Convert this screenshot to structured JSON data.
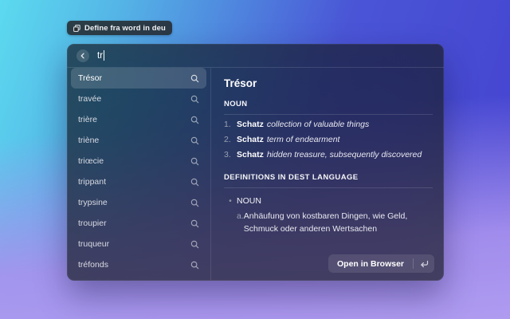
{
  "colors": {
    "backdrop_top_left": "#5cdaf0",
    "backdrop_top_right": "#4441d0",
    "backdrop_bottom": "#af9cf0",
    "window_tint": "rgba(26,30,40,0.72)",
    "selection": "rgba(255,255,255,0.15)"
  },
  "launcher_badge": {
    "icon": "window-copy-icon",
    "label": "Define fra word in deu"
  },
  "window": {
    "search": {
      "value": "tr",
      "back_icon": "chevron-left-icon"
    },
    "results": [
      {
        "label": "Trésor",
        "selected": true
      },
      {
        "label": "travée"
      },
      {
        "label": "trière"
      },
      {
        "label": "triène"
      },
      {
        "label": "triœcie"
      },
      {
        "label": "trippant"
      },
      {
        "label": "trypsine"
      },
      {
        "label": "troupier"
      },
      {
        "label": "truqueur"
      },
      {
        "label": "tréfonds"
      }
    ],
    "detail": {
      "title": "Trésor",
      "pos_heading": "NOUN",
      "definitions": [
        {
          "num": "1.",
          "word": "Schatz",
          "gloss": "collection of valuable things"
        },
        {
          "num": "2.",
          "word": "Schatz",
          "gloss": "term of endearment"
        },
        {
          "num": "3.",
          "word": "Schatz",
          "gloss": "hidden treasure, subsequently discovered"
        }
      ],
      "dest_heading": "DEFINITIONS IN DEST LANGUAGE",
      "dest_bullet": "•",
      "dest_pos": "NOUN",
      "dest_items": [
        {
          "prefix": "a.",
          "text": "Anhäufung von kostbaren Dingen, wie Geld, Schmuck oder anderen Wertsachen"
        }
      ]
    },
    "action_bar": {
      "open_label": "Open in Browser",
      "shortcut_icon": "enter-key-icon"
    }
  }
}
